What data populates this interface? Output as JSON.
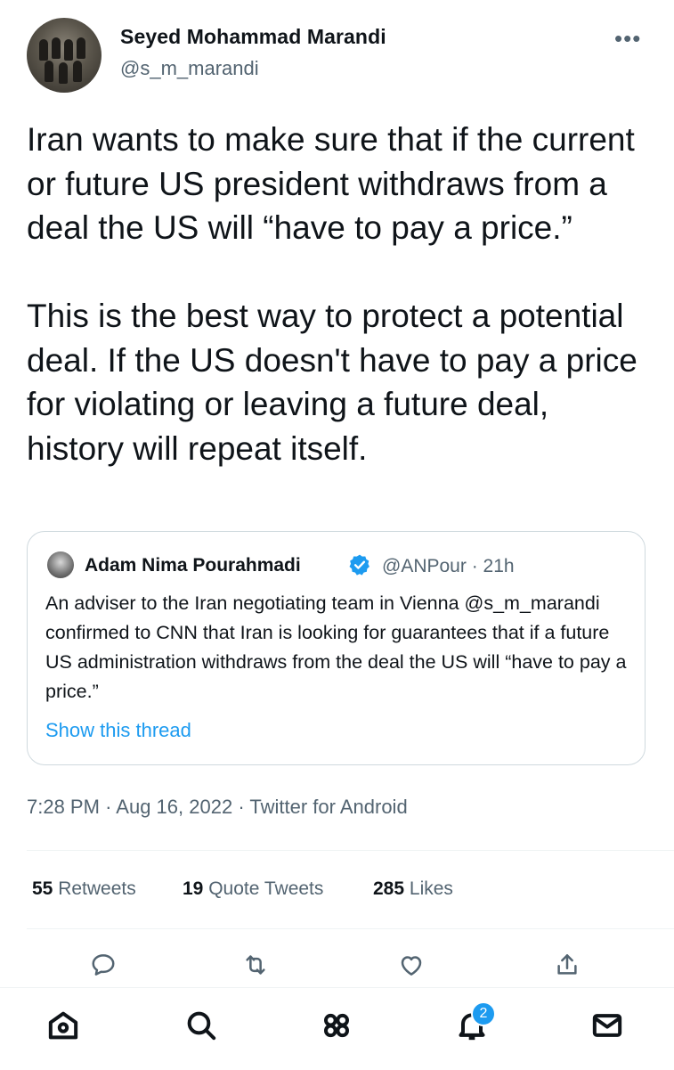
{
  "tweet": {
    "display_name": "Seyed Mohammad Marandi",
    "handle": "@s_m_marandi",
    "text": "Iran wants to make sure that if the current or future US president withdraws from a deal the US will “have to pay a price.”\n\nThis is the best way to protect a potential deal. If the US doesn't have to pay a price for violating or leaving a future deal, history will repeat itself.",
    "time": "7:28 PM",
    "date": "Aug 16, 2022",
    "source": "Twitter for Android",
    "separator": "·"
  },
  "quoted": {
    "display_name": "Adam Nima Pourahmadi",
    "handle": "@ANPour",
    "age": "21h",
    "text": "An adviser to the Iran negotiating team in Vienna @s_m_marandi confirmed to CNN that Iran is looking for guarantees that if a future US administration withdraws from the deal the US will “have to pay a price.”",
    "show_thread": "Show this thread",
    "verified": true
  },
  "stats": [
    {
      "count": "55",
      "label": "Retweets"
    },
    {
      "count": "19",
      "label": "Quote Tweets"
    },
    {
      "count": "285",
      "label": "Likes"
    }
  ],
  "actions": [
    "reply-icon",
    "retweet-icon",
    "like-icon",
    "share-icon"
  ],
  "tabbar": {
    "tabs": [
      "home-icon",
      "search-icon",
      "communities-icon",
      "notifications-icon",
      "messages-icon"
    ],
    "notification_badge": "2"
  },
  "colors": {
    "accent": "#1d9bf0",
    "secondary_text": "#536471",
    "primary_text": "#0f1419"
  }
}
